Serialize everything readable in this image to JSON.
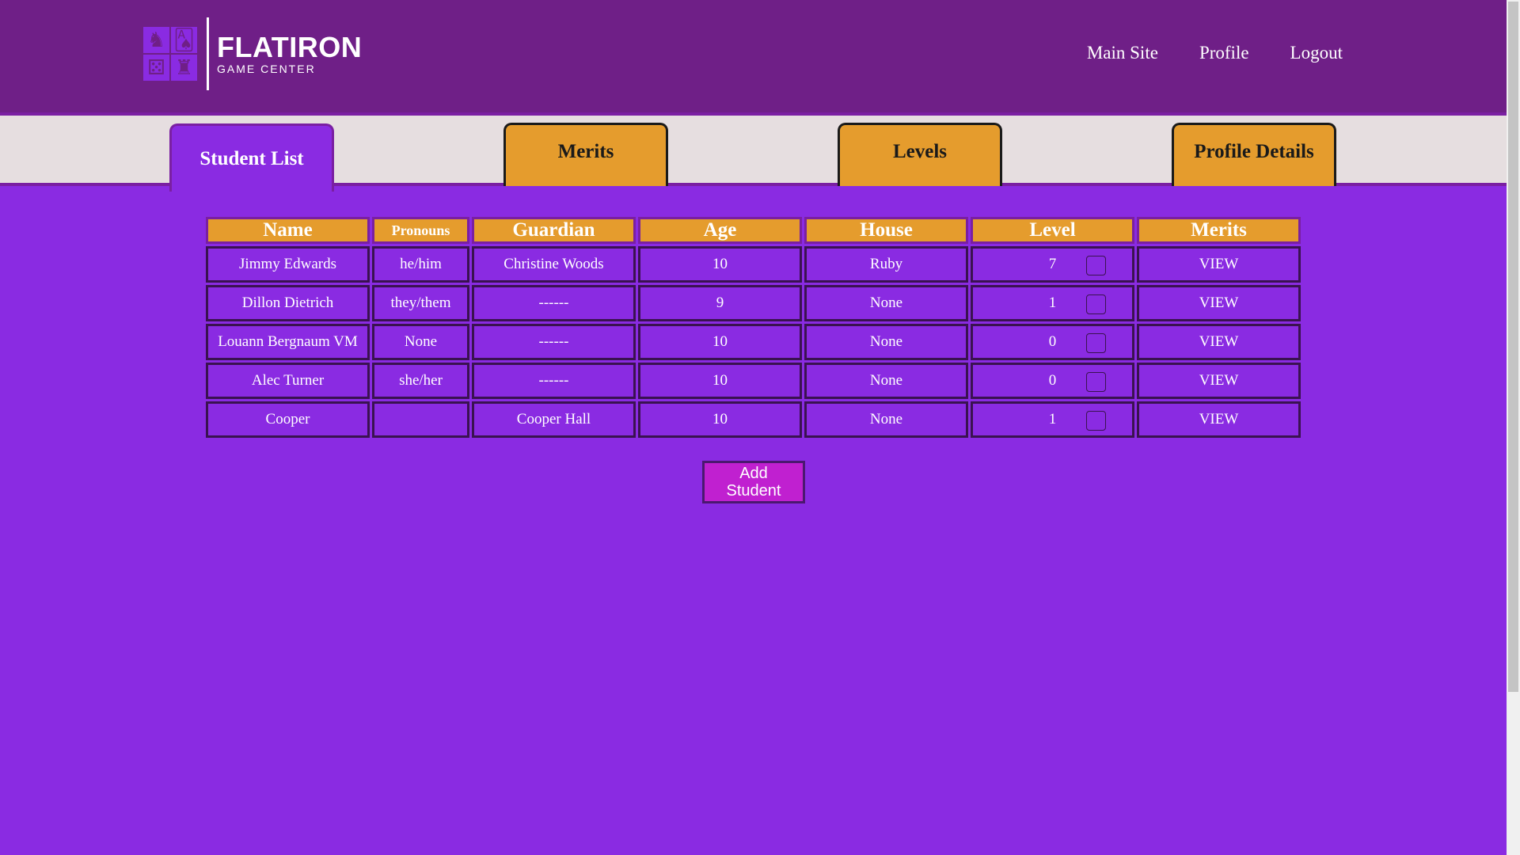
{
  "colors": {
    "header": "#6f1f87",
    "page": "#8a2be2",
    "tab": "#e59c2d",
    "button": "#c020d0"
  },
  "logo": {
    "title": "FLATIRON",
    "subtitle": "GAME CENTER",
    "icons": [
      "knight-icon",
      "cards-icon",
      "dice-icon",
      "rook-icon"
    ]
  },
  "nav": {
    "main_site": "Main Site",
    "profile": "Profile",
    "logout": "Logout"
  },
  "tabs": [
    {
      "label": "Student List",
      "active": true
    },
    {
      "label": "Merits",
      "active": false
    },
    {
      "label": "Levels",
      "active": false
    },
    {
      "label": "Profile Details",
      "active": false
    }
  ],
  "table": {
    "headers": [
      "Name",
      "Pronouns",
      "Guardian",
      "Age",
      "House",
      "Level",
      "Merits"
    ],
    "rows": [
      {
        "name": "Jimmy Edwards",
        "pronouns": "he/him",
        "guardian": "Christine Woods",
        "age": "10",
        "house": "Ruby",
        "level": "7",
        "merits": "VIEW"
      },
      {
        "name": "Dillon Dietrich",
        "pronouns": "they/them",
        "guardian": "------",
        "age": "9",
        "house": "None",
        "level": "1",
        "merits": "VIEW"
      },
      {
        "name": "Louann Bergnaum VM",
        "pronouns": "None",
        "guardian": "------",
        "age": "10",
        "house": "None",
        "level": "0",
        "merits": "VIEW"
      },
      {
        "name": "Alec Turner",
        "pronouns": "she/her",
        "guardian": "------",
        "age": "10",
        "house": "None",
        "level": "0",
        "merits": "VIEW"
      },
      {
        "name": "Cooper",
        "pronouns": "",
        "guardian": "Cooper Hall",
        "age": "10",
        "house": "None",
        "level": "1",
        "merits": "VIEW"
      }
    ]
  },
  "add_button": "Add Student"
}
